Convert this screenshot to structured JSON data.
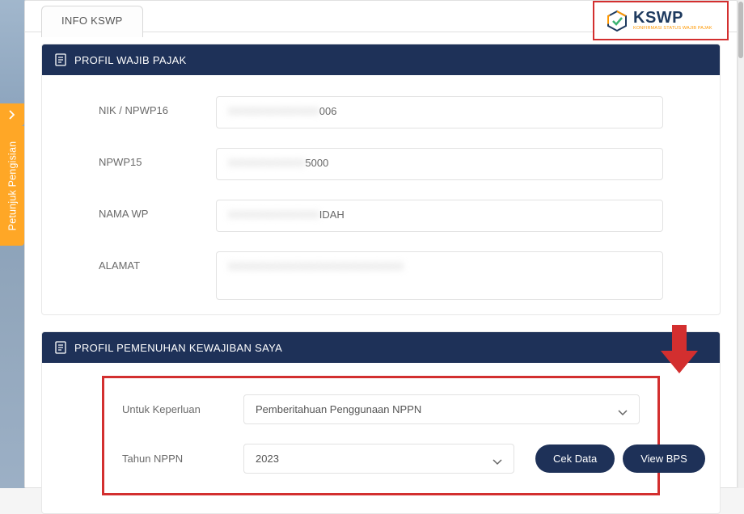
{
  "header": {
    "tab": "INFO KSWP"
  },
  "logo": {
    "title": "KSWP",
    "subtitle": "KONFIRMASI STATUS WAJIB PAJAK"
  },
  "sidebar": {
    "label": "Petunjuk Pengisian"
  },
  "panel_profile": {
    "title": "PROFIL WAJIB PAJAK",
    "fields": {
      "nik_npwp16": {
        "label": "NIK / NPWP16",
        "masked_prefix": "XXXXXXXXXXXXX",
        "suffix": "006"
      },
      "npwp15": {
        "label": "NPWP15",
        "masked_prefix": "XXXXXXXXXXX",
        "suffix": "5000"
      },
      "nama_wp": {
        "label": "NAMA WP",
        "masked_prefix": "XXXXXXXXXXXXX",
        "suffix": "IDAH"
      },
      "alamat": {
        "label": "ALAMAT",
        "masked_prefix": "XXXXXXXXXXXXXXXXXXXXXXXXX",
        "suffix": ""
      }
    }
  },
  "panel_obligation": {
    "title": "PROFIL PEMENUHAN KEWAJIBAN SAYA",
    "fields": {
      "keperluan": {
        "label": "Untuk Keperluan",
        "value": "Pemberitahuan Penggunaan NPPN"
      },
      "tahun": {
        "label": "Tahun NPPN",
        "value": "2023"
      }
    },
    "buttons": {
      "cek": "Cek Data",
      "view": "View BPS"
    }
  }
}
